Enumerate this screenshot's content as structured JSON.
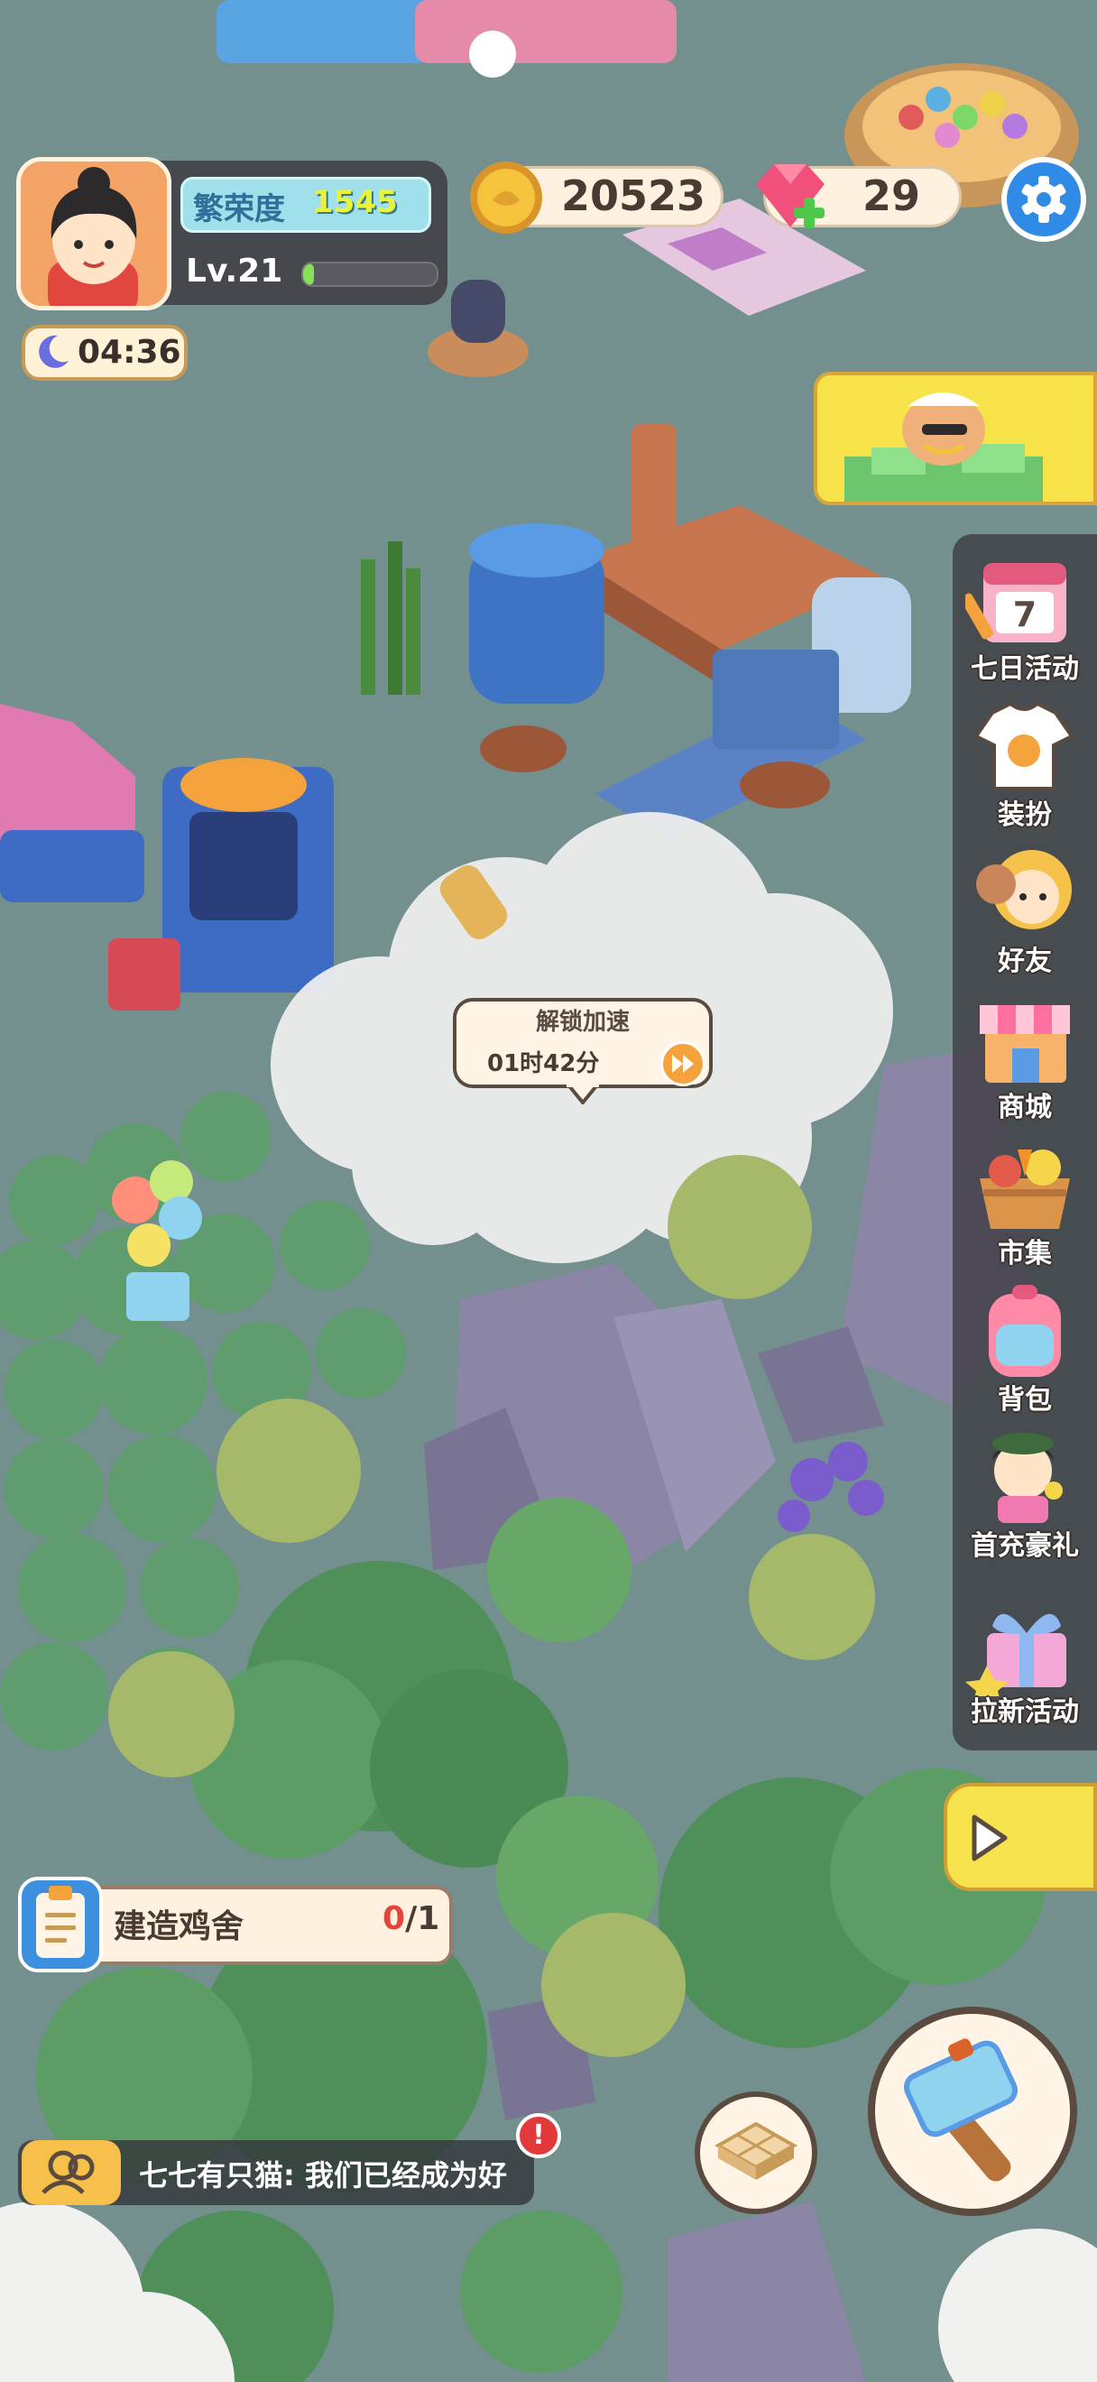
{
  "player": {
    "prosperity_label": "繁荣度",
    "prosperity_value": "1545",
    "level": "Lv.21",
    "level_progress": 0.08,
    "night_timer": "04:36"
  },
  "currency": {
    "coins": "20523",
    "gems": "29"
  },
  "icons": {
    "settings": "gear-icon",
    "moon": "moon-icon",
    "coin": "coin-icon",
    "gem": "gem-plus-icon"
  },
  "side_menu": [
    {
      "label": "七日活动",
      "icon": "calendar-icon"
    },
    {
      "label": "装扮",
      "icon": "shirt-icon"
    },
    {
      "label": "好友",
      "icon": "friend-icon"
    },
    {
      "label": "商城",
      "icon": "shop-icon"
    },
    {
      "label": "市集",
      "icon": "market-basket-icon"
    },
    {
      "label": "背包",
      "icon": "backpack-icon"
    },
    {
      "label": "首充豪礼",
      "icon": "first-recharge-icon"
    },
    {
      "label": "拉新活动",
      "icon": "gift-box-icon"
    }
  ],
  "unlock": {
    "title": "解锁加速",
    "time": "01时42分"
  },
  "quest": {
    "name": "建造鸡舍",
    "progress_done": "0",
    "progress_total": "/1"
  },
  "chat": {
    "message": "七七有只猫: 我们已经成为好"
  },
  "alert": "!",
  "colors": {
    "ground": "#6f8a88",
    "panel": "#3a383e",
    "accent_yellow": "#f7e24a",
    "button_blue": "#2f8be6"
  }
}
